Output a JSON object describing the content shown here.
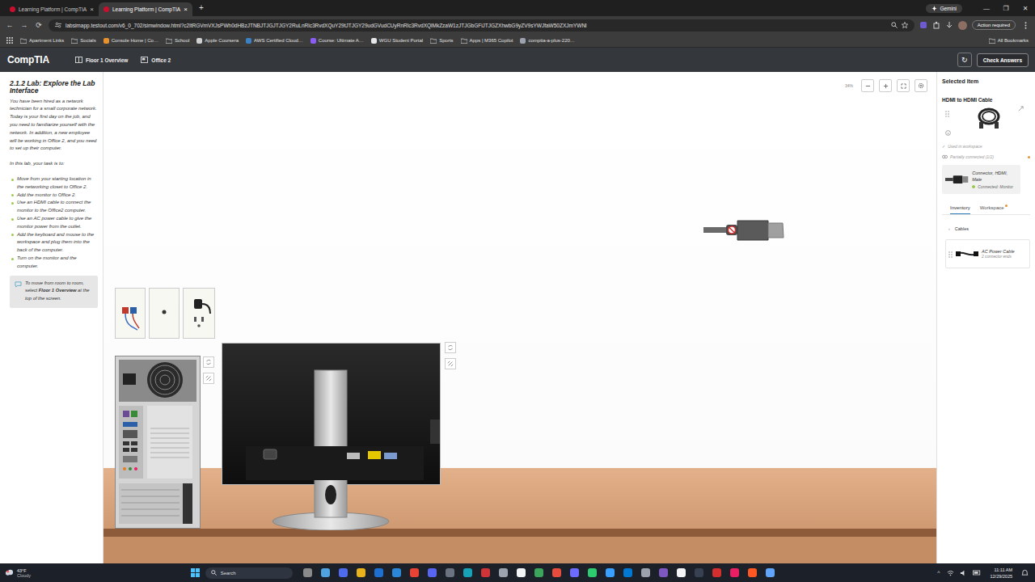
{
  "browser": {
    "tabs": [
      {
        "label": "Learning Platform | CompTIA",
        "selected": false,
        "close": "×"
      },
      {
        "label": "Learning Platform | CompTIA",
        "selected": true,
        "close": "×"
      }
    ],
    "new_tab": "+",
    "gemini": "Gemini",
    "window_controls": [
      "—",
      "❐",
      "✕"
    ],
    "nav": [
      "←",
      "→",
      "⟳"
    ],
    "url": "labsimapp.testout.com/v6_0_702/simwindow.html?c2ltRGVmVXJsPWh0dHBzJTNBJTJGJTJGY2RuLnRlc3RvdXQuY29tJTJGY29udGVudCUyRnRlc3RvdXQlMkZzaW1zJTJGbGFiJTJGZXhwbG9yZV9sYWJfaW50ZXJmYWNl",
    "action": "Action required",
    "bookmarks": [
      {
        "label": "Apartment Links",
        "kind": "folder"
      },
      {
        "label": "Socials",
        "kind": "folder"
      },
      {
        "label": "Console Home | Co…",
        "kind": "link",
        "color": "#e8912d"
      },
      {
        "label": "School",
        "kind": "folder"
      },
      {
        "label": "Apple Coursera",
        "kind": "link",
        "color": "#d0d0d0"
      },
      {
        "label": "AWS Certified Cloud…",
        "kind": "link",
        "color": "#3b82c4"
      },
      {
        "label": "Course: Ultimate A…",
        "kind": "link",
        "color": "#8b5cf6"
      },
      {
        "label": "WGU Student Portal",
        "kind": "link",
        "color": "#e5e7eb"
      },
      {
        "label": "Sports",
        "kind": "folder"
      },
      {
        "label": "Apps | M365 Copilot",
        "kind": "folder"
      },
      {
        "label": "comptia-a-plus-220…",
        "kind": "link",
        "color": "#9ca3af"
      }
    ],
    "all_bookmarks": "All Bookmarks"
  },
  "app": {
    "logo": "CompTIA",
    "crumbs": [
      {
        "label": "Floor 1 Overview"
      },
      {
        "label": "Office 2"
      }
    ],
    "refresh": "↻",
    "check_answers": "Check Answers"
  },
  "instructions": {
    "title": "2.1.2 Lab: Explore the Lab Interface",
    "intro": "You have been hired as a network technician for a small corporate network. Today is your first day on the job, and you need to familiarize yourself with the network. In addition, a new employee will be working in Office 2, and you need to set up their computer.",
    "task_lead": "In this lab, your task is to:",
    "tasks": [
      "Move from your starting location in the networking closet to Office 2.",
      "Add the monitor to Office 2.",
      "Use an HDMI cable to connect the monitor to the Office2 computer.",
      "Use an AC power cable to give the monitor power from the outlet.",
      "Add the keyboard and mouse to the workspace and plug them into the back of the computer.",
      "Turn on the monitor and the computer."
    ],
    "tip": {
      "before": "To move from room to room, select ",
      "bold": "Floor 1 Overview",
      "after": " at the top of the screen."
    }
  },
  "canvas": {
    "zoom": "34%",
    "monitor": {
      "hdmi_port_connected": true
    },
    "hdmi_free_end": {
      "connected": false
    }
  },
  "selected_item": {
    "heading": "Selected Item",
    "name": "HDMI to HDMI Cable",
    "used": {
      "check": "✓",
      "label": "Used in workspace"
    },
    "partial": {
      "label": "Partially connected (1/2)"
    },
    "connectors": [
      {
        "label": "Connector, HDMI, Male",
        "connected_label": "Connected: Monitor",
        "connected": true
      }
    ],
    "tabs": [
      {
        "label": "Inventory",
        "selected": true,
        "dot": false
      },
      {
        "label": "Workspace",
        "selected": false,
        "dot": true
      }
    ],
    "category": {
      "back": "‹",
      "label": "Cables"
    },
    "items": [
      {
        "name": "AC Power Cable",
        "detail": "2 connector ends"
      }
    ]
  },
  "taskbar": {
    "weather": {
      "temp": "43°F",
      "condition": "Cloudy"
    },
    "search": "Search",
    "apps": [
      {
        "color": "#8a8a8a"
      },
      {
        "color": "#4ea3e0"
      },
      {
        "color": "#4f6bed"
      },
      {
        "color": "#e8b21c"
      },
      {
        "color": "#1f6fd1"
      },
      {
        "color": "#2b88d8"
      },
      {
        "color": "#ea4335"
      },
      {
        "color": "#5865f2"
      },
      {
        "color": "#6b7280"
      },
      {
        "color": "#17a2b8"
      },
      {
        "color": "#d13438"
      },
      {
        "color": "#9ca3af"
      },
      {
        "color": "#f3f4f6"
      },
      {
        "color": "#3ba55c"
      },
      {
        "color": "#e74c3c"
      },
      {
        "color": "#6c6cff"
      },
      {
        "color": "#2ecc71"
      },
      {
        "color": "#3aa0ff"
      },
      {
        "color": "#0078d4"
      },
      {
        "color": "#9ca3af"
      },
      {
        "color": "#7e57c2"
      },
      {
        "color": "#f3f4f6"
      },
      {
        "color": "#374151"
      },
      {
        "color": "#d32f2f"
      },
      {
        "color": "#e91e63"
      },
      {
        "color": "#ff5722"
      },
      {
        "color": "#60a5fa"
      }
    ],
    "tray_up": "^",
    "time": "11:11 AM",
    "date": "12/29/2025"
  }
}
